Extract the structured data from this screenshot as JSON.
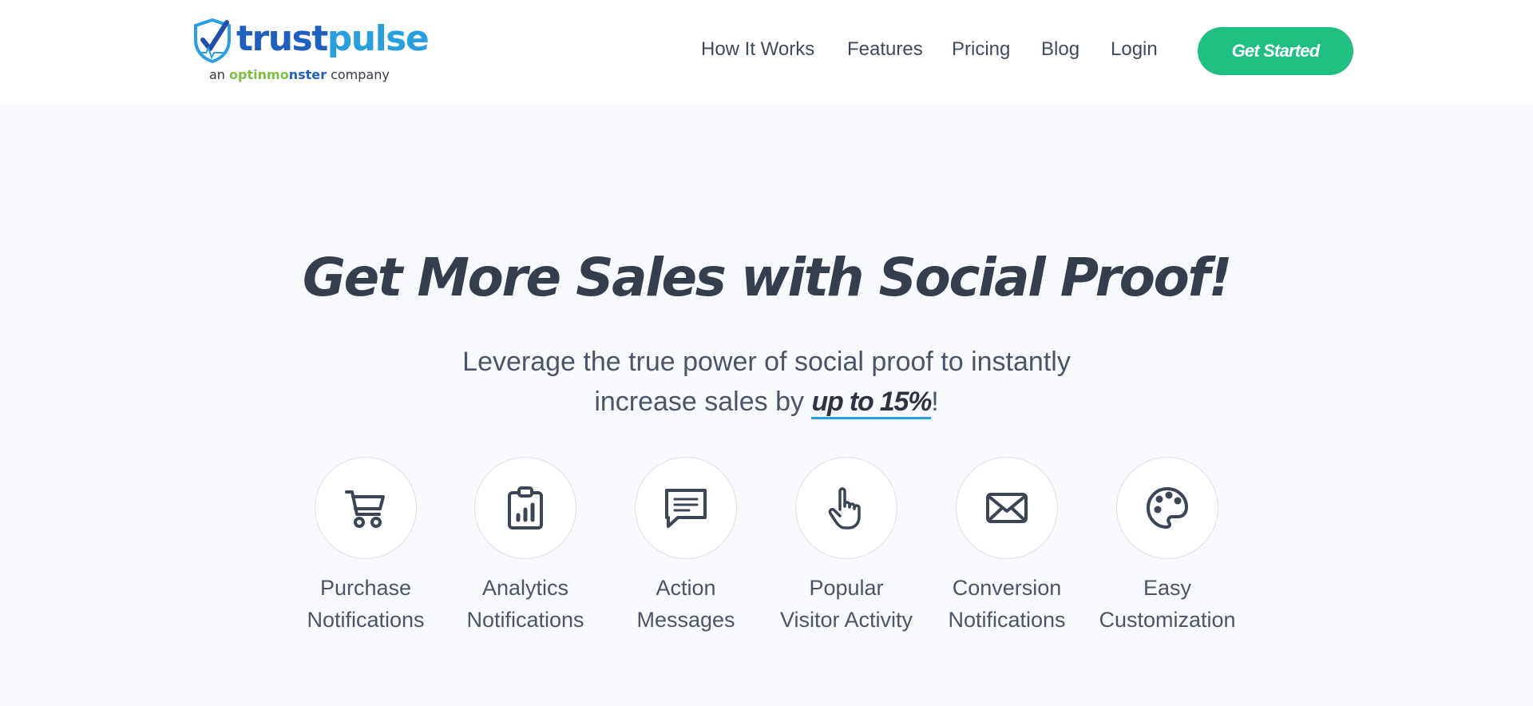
{
  "brand": {
    "name_part1": "trust",
    "name_part2": "pulse",
    "tagline_prefix": "an",
    "tagline_brand_a": "optinm",
    "tagline_brand_ball": "o",
    "tagline_brand_b": "nster",
    "tagline_suffix": "company",
    "primary_color": "#1f5fbf",
    "accent_color": "#2a9fe0"
  },
  "nav": {
    "items": [
      {
        "label": "How It Works"
      },
      {
        "label": "Features"
      },
      {
        "label": "Pricing"
      },
      {
        "label": "Blog"
      },
      {
        "label": "Login"
      }
    ],
    "cta_label": "Get Started",
    "cta_color": "#1fbf82"
  },
  "hero": {
    "title": "Get More Sales with Social Proof!",
    "subtitle_line1": "Leverage the true power of social proof to instantly",
    "subtitle_line2_prefix": "increase sales by ",
    "subtitle_highlight": "up to 15%",
    "subtitle_line2_suffix": "!"
  },
  "features": [
    {
      "icon": "shopping-cart-icon",
      "line1": "Purchase",
      "line2": "Notifications"
    },
    {
      "icon": "clipboard-chart-icon",
      "line1": "Analytics",
      "line2": "Notifications"
    },
    {
      "icon": "message-icon",
      "line1": "Action",
      "line2": "Messages"
    },
    {
      "icon": "pointer-hand-icon",
      "line1": "Popular",
      "line2": "Visitor Activity"
    },
    {
      "icon": "envelope-icon",
      "line1": "Conversion",
      "line2": "Notifications"
    },
    {
      "icon": "palette-icon",
      "line1": "Easy",
      "line2": "Customization"
    }
  ]
}
